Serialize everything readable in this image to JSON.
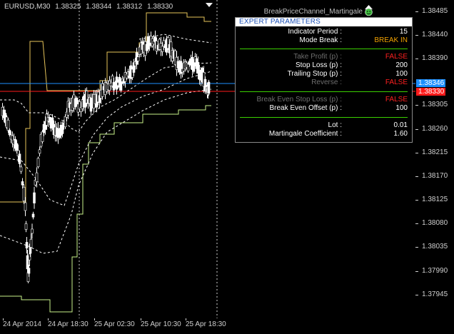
{
  "header": {
    "symbol": "EURUSD,M30",
    "open": "1.38325",
    "high": "1.38344",
    "low": "1.38312",
    "close": "1.38330",
    "expert_name": "BreakPriceChannel_Martingale",
    "expert_icon": "smiley-hat-icon"
  },
  "panel": {
    "title": "EXPERT PARAMETERS",
    "rows": [
      {
        "label": "Indicator Period :",
        "value": "15",
        "label_color": "white",
        "value_color": "white"
      },
      {
        "label": "Mode Break :",
        "value": "BREAK IN",
        "label_color": "white",
        "value_color": "orange"
      },
      {
        "label": "Take Profit (p) :",
        "value": "FALSE",
        "label_color": "grey",
        "value_color": "red"
      },
      {
        "label": "Stop Loss (p) :",
        "value": "200",
        "label_color": "white",
        "value_color": "white"
      },
      {
        "label": "Trailing Stop (p) :",
        "value": "100",
        "label_color": "white",
        "value_color": "white"
      },
      {
        "label": "Reverse :",
        "value": "FALSE",
        "label_color": "grey",
        "value_color": "red"
      },
      {
        "label": "Break Even Stop Loss (p) :",
        "value": "FALSE",
        "label_color": "grey",
        "value_color": "red"
      },
      {
        "label": "Break Even Offset (p) :",
        "value": "100",
        "label_color": "white",
        "value_color": "white"
      },
      {
        "label": "Lot :",
        "value": "0.01",
        "label_color": "white",
        "value_color": "white"
      },
      {
        "label": "Martingale Coefficient :",
        "value": "1.60",
        "label_color": "white",
        "value_color": "white"
      }
    ]
  },
  "price_axis": {
    "ticks": [
      "1.38485",
      "1.38440",
      "1.38390",
      "1.38305",
      "1.38260",
      "1.38215",
      "1.38170",
      "1.38125",
      "1.38080",
      "1.38035",
      "1.37990",
      "1.37945"
    ],
    "ask": "1.38346",
    "bid": "1.38330",
    "ask_color": "#1e90ff",
    "bid_color": "#ff1a1a"
  },
  "time_axis": {
    "labels": [
      "24 Apr 2014",
      "24 Apr 18:30",
      "25 Apr 02:30",
      "25 Apr 10:30",
      "25 Apr 18:30"
    ]
  },
  "colors": {
    "upper_channel": "#e6c45a",
    "lower_channel": "#c9f28a",
    "middle_dashed": "#ffffff",
    "candles": "#ffffff",
    "separator": "#3bd000"
  }
}
